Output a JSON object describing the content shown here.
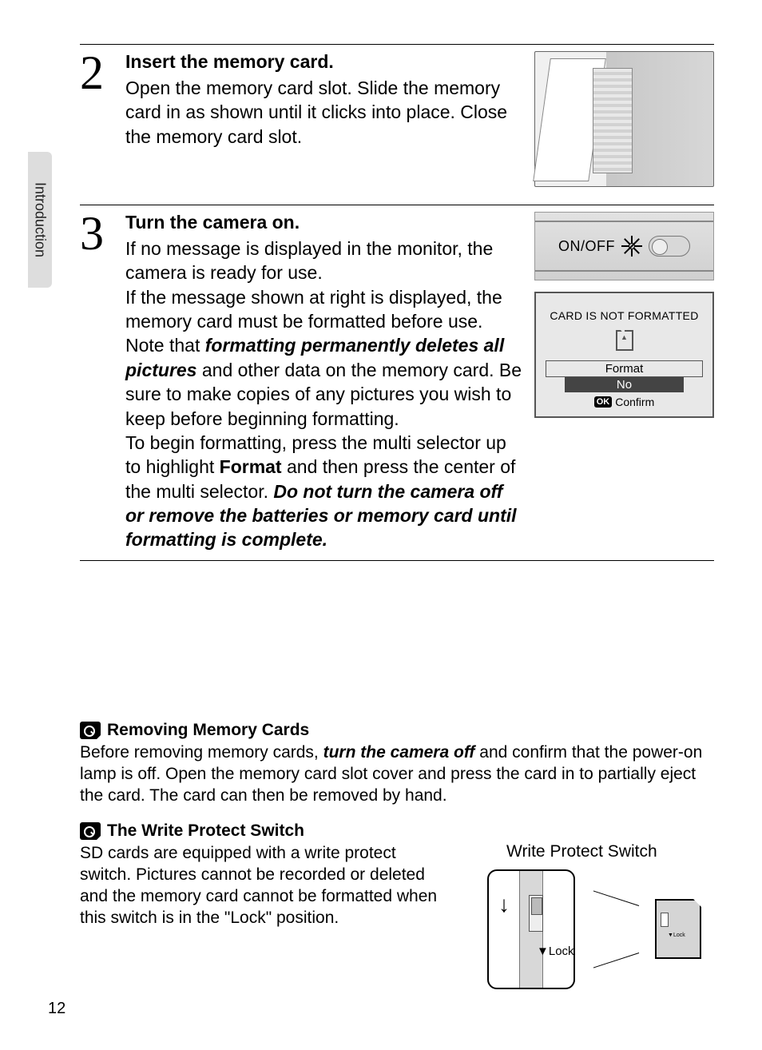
{
  "sideTab": "Introduction",
  "pageNumber": "12",
  "step2": {
    "num": "2",
    "title": "Insert the memory card.",
    "text": "Open the memory card slot. Slide the memory card in as shown until it clicks into place. Close the memory card slot."
  },
  "step3": {
    "num": "3",
    "title": "Turn the camera on.",
    "p1": "If no message is displayed in the monitor, the camera is ready for use.",
    "p2": "If the message shown at right is displayed, the memory card must be formatted before use. Note that ",
    "p2_em": "formatting permanently deletes all pictures",
    "p2b": " and other data on the memory card. Be sure to make copies of any pictures you wish to keep before beginning formatting.",
    "p3a": "To begin formatting, press the multi selector up to highlight ",
    "p3_b": "Format",
    "p3c": " and then press the center of the multi selector. ",
    "p3_em": "Do not turn the camera off or remove the batteries or memory card until formatting is complete."
  },
  "onoff": {
    "label": "ON/OFF"
  },
  "screen": {
    "msg": "CARD IS NOT FORMATTED",
    "format": "Format",
    "no": "No",
    "ok": "OK",
    "confirm": "Confirm"
  },
  "noteRemove": {
    "title": "Removing Memory Cards",
    "t1": "Before removing memory cards, ",
    "em": "turn the camera off",
    "t2": " and confirm that the power-on lamp is off. Open the memory card slot cover and press the card in to partially eject the card. The card can then be removed by hand."
  },
  "noteWP": {
    "title": "The Write Protect Switch",
    "text": "SD cards are equipped with a write protect switch. Pictures cannot be recorded or deleted and the memory card cannot be formatted when this switch is in the \"Lock\" position.",
    "caption": "Write Protect Switch",
    "lock": "Lock",
    "lock2": "Lock"
  }
}
